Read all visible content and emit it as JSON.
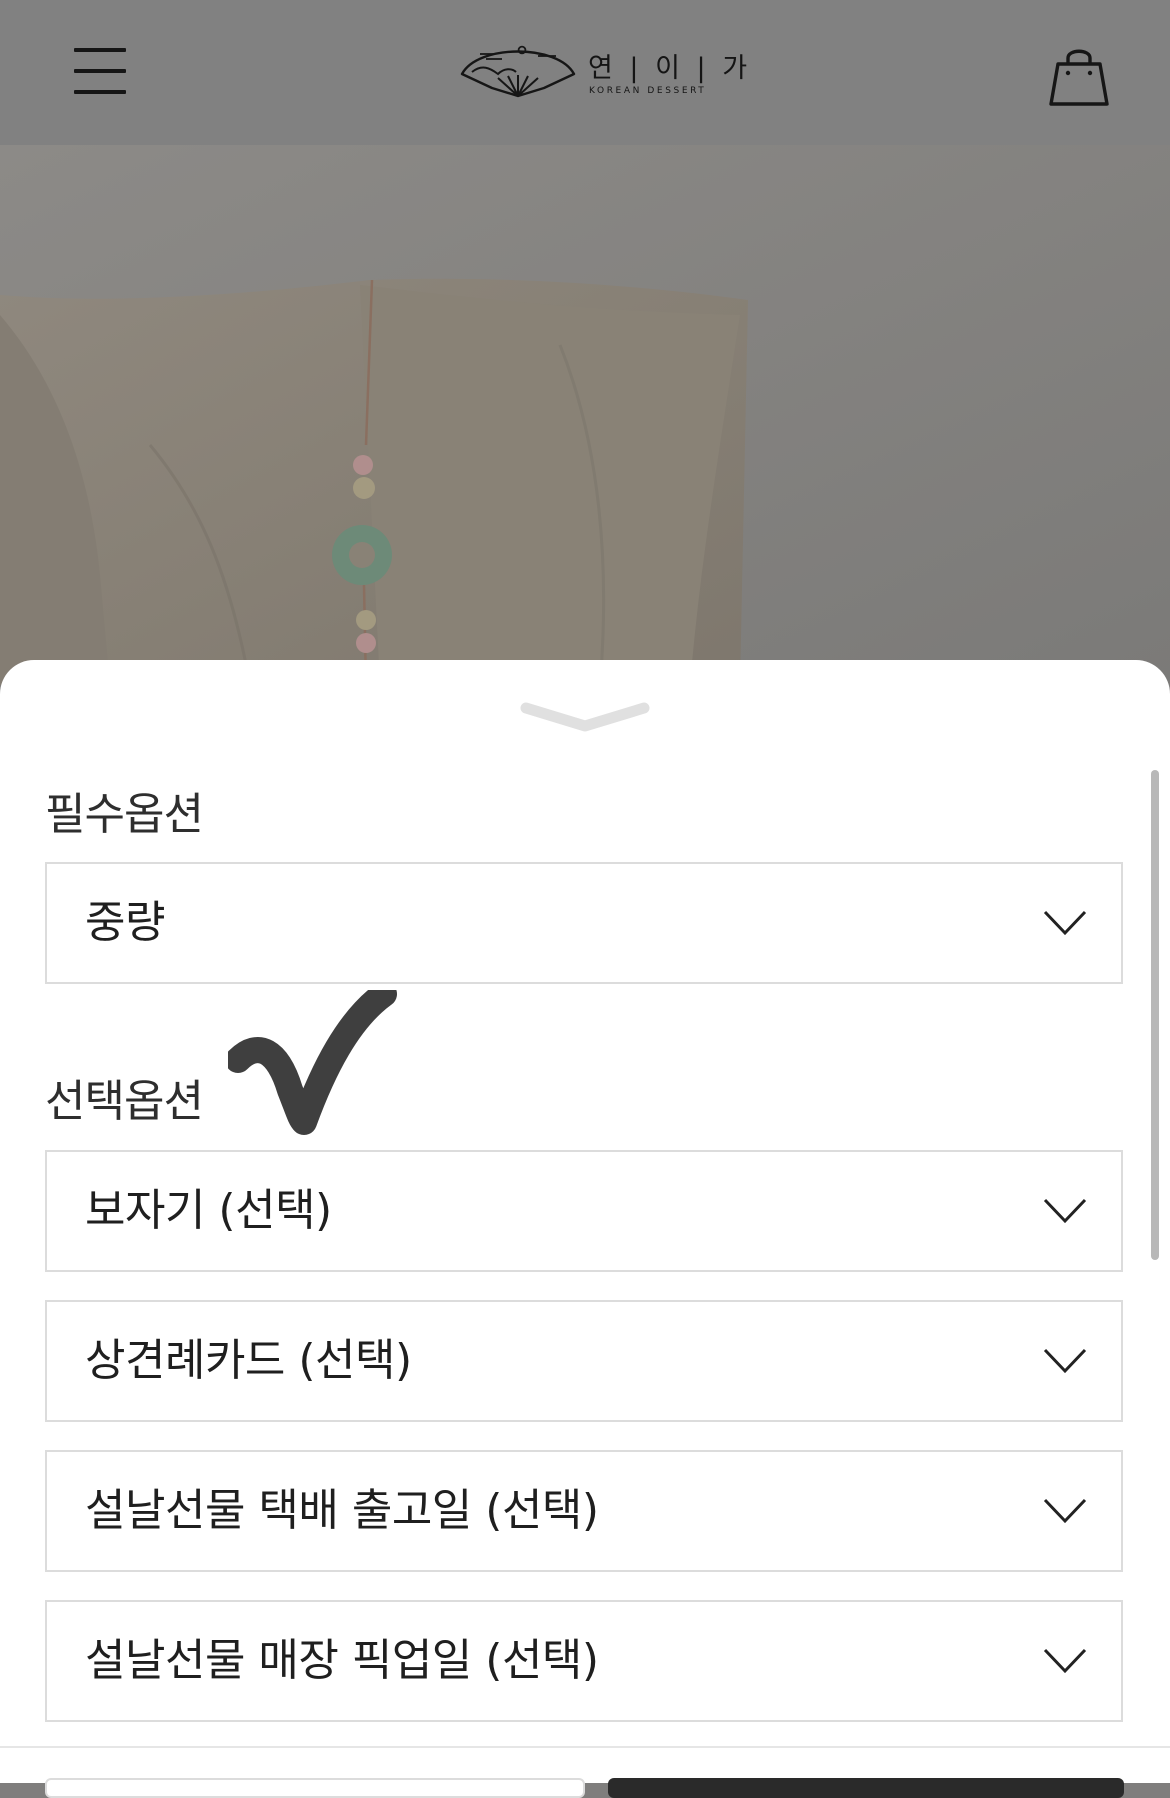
{
  "header": {
    "logo_text": "연 | 이 | 가",
    "logo_subtitle": "KOREAN DESSERT",
    "menu_icon": "hamburger-menu-icon",
    "cart_icon": "shopping-bag-icon"
  },
  "hero": {
    "image": "silk-bojagi-wrapped-gift-with-jade-norigae"
  },
  "options": {
    "required_label": "필수옵션",
    "required_selects": [
      {
        "label": "중량"
      }
    ],
    "optional_label": "선택옵션",
    "optional_selects": [
      {
        "label": "보자기 (선택)"
      },
      {
        "label": "상견례카드 (선택)"
      },
      {
        "label": "설날선물 택배 출고일 (선택)"
      },
      {
        "label": "설날선물 매장 픽업일 (선택)"
      }
    ]
  },
  "colors": {
    "header_bg": "#818181",
    "sheet_bg": "#ffffff",
    "border": "#dcdcdc",
    "text": "#1f1f1f",
    "checkmark": "#3f3f3f"
  }
}
